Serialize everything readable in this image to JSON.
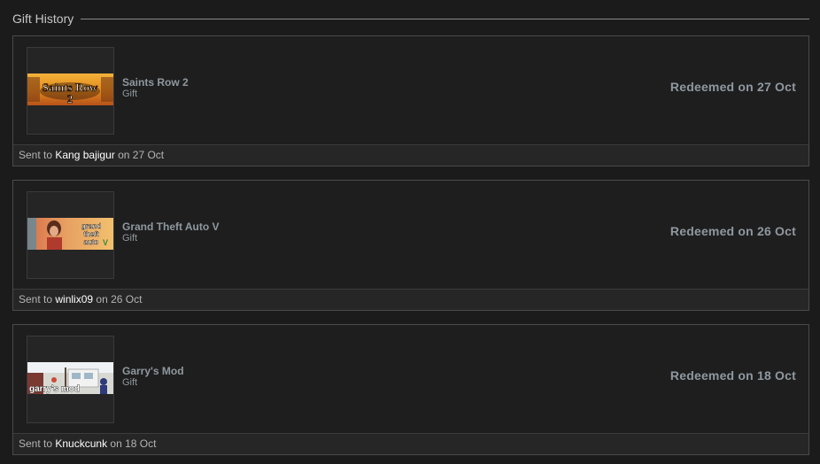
{
  "section": {
    "title": "Gift History"
  },
  "gifts": [
    {
      "name": "Saints Row 2",
      "type": "Gift",
      "status": "Redeemed on 27 Oct",
      "sent_prefix": "Sent to",
      "recipient": "Kang bajigur",
      "sent_suffix": "on 27 Oct",
      "capsule_logo": "Saints Row"
    },
    {
      "name": "Grand Theft Auto V",
      "type": "Gift",
      "status": "Redeemed on 26 Oct",
      "sent_prefix": "Sent to",
      "recipient": "winlix09",
      "sent_suffix": "on 26 Oct",
      "capsule_logo": "grand theft auto"
    },
    {
      "name": "Garry's Mod",
      "type": "Gift",
      "status": "Redeemed on 18 Oct",
      "sent_prefix": "Sent to",
      "recipient": "Knuckcunk",
      "sent_suffix": "on 18 Oct",
      "capsule_logo": "garry's mod"
    }
  ],
  "colors": {
    "background": "#1b1b1b",
    "card_border": "#4a4a4a",
    "muted_text": "#8f98a0",
    "recipient_text": "#ffffff"
  }
}
